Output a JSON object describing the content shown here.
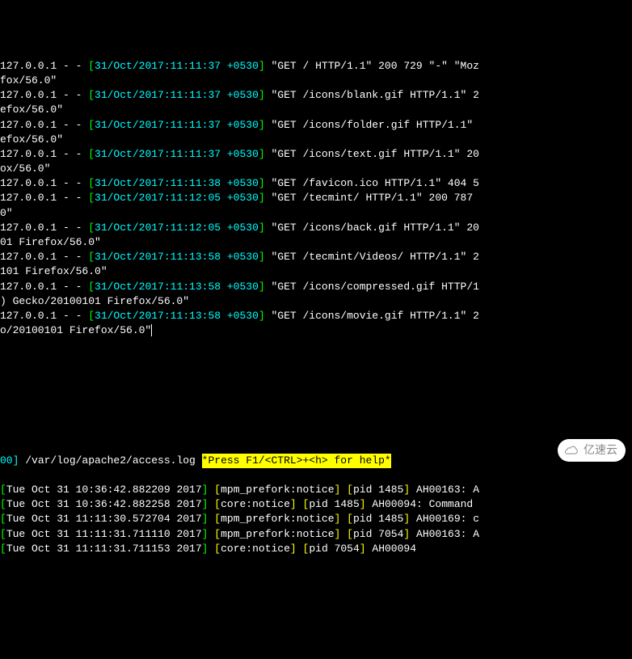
{
  "access_log": [
    {
      "ip": "127.0.0.1",
      "client": "- -",
      "ts": "31/Oct/2017:11:11:37 +0530",
      "req": "\"GET / HTTP/1.1\" 200 729 \"-\" \"Moz",
      "wrap": "fox/56.0\""
    },
    {
      "ip": "127.0.0.1",
      "client": "- -",
      "ts": "31/Oct/2017:11:11:37 +0530",
      "req": "\"GET /icons/blank.gif HTTP/1.1\" 2",
      "wrap": "efox/56.0\""
    },
    {
      "ip": "127.0.0.1",
      "client": "- -",
      "ts": "31/Oct/2017:11:11:37 +0530",
      "req": "\"GET /icons/folder.gif HTTP/1.1\"",
      "wrap": "efox/56.0\""
    },
    {
      "ip": "127.0.0.1",
      "client": "- -",
      "ts": "31/Oct/2017:11:11:37 +0530",
      "req": "\"GET /icons/text.gif HTTP/1.1\" 20",
      "wrap": "ox/56.0\""
    },
    {
      "ip": "127.0.0.1",
      "client": "- -",
      "ts": "31/Oct/2017:11:11:38 +0530",
      "req": "\"GET /favicon.ico HTTP/1.1\" 404 5",
      "wrap": ""
    },
    {
      "ip": "127.0.0.1",
      "client": "- -",
      "ts": "31/Oct/2017:11:12:05 +0530",
      "req": "\"GET /tecmint/ HTTP/1.1\" 200 787",
      "wrap": "0\""
    },
    {
      "ip": "127.0.0.1",
      "client": "- -",
      "ts": "31/Oct/2017:11:12:05 +0530",
      "req": "\"GET /icons/back.gif HTTP/1.1\" 20",
      "wrap": "01 Firefox/56.0\""
    },
    {
      "ip": "127.0.0.1",
      "client": "- -",
      "ts": "31/Oct/2017:11:13:58 +0530",
      "req": "\"GET /tecmint/Videos/ HTTP/1.1\" 2",
      "wrap": "101 Firefox/56.0\""
    },
    {
      "ip": "127.0.0.1",
      "client": "- -",
      "ts": "31/Oct/2017:11:13:58 +0530",
      "req": "\"GET /icons/compressed.gif HTTP/1",
      "wrap": ") Gecko/20100101 Firefox/56.0\""
    },
    {
      "ip": "127.0.0.1",
      "client": "- -",
      "ts": "31/Oct/2017:11:13:58 +0530",
      "req": "\"GET /icons/movie.gif HTTP/1.1\" 2",
      "wrap": "o/20100101 Firefox/56.0\""
    }
  ],
  "status": {
    "prefix": "00]",
    "path": "/var/log/apache2/access.log",
    "help": "*Press F1/<CTRL>+<h> for help*"
  },
  "syslog": [
    {
      "ts": "Tue Oct 31 10:36:42.882209 2017",
      "mod": "mpm_prefork:notice",
      "pid": "pid 1485",
      "msg": "AH00163: A"
    },
    {
      "ts": "Tue Oct 31 10:36:42.882258 2017",
      "mod": "core:notice",
      "pid": "pid 1485",
      "msg": "AH00094: Command"
    },
    {
      "ts": "Tue Oct 31 11:11:30.572704 2017",
      "mod": "mpm_prefork:notice",
      "pid": "pid 1485",
      "msg": "AH00169: c"
    },
    {
      "ts": "Tue Oct 31 11:11:31.711110 2017",
      "mod": "mpm_prefork:notice",
      "pid": "pid 7054",
      "msg": "AH00163: A"
    },
    {
      "ts": "Tue Oct 31 11:11:31.711153 2017",
      "mod": "core:notice",
      "pid": "pid 7054",
      "msg": "AH00094"
    }
  ],
  "watermark": "亿速云"
}
